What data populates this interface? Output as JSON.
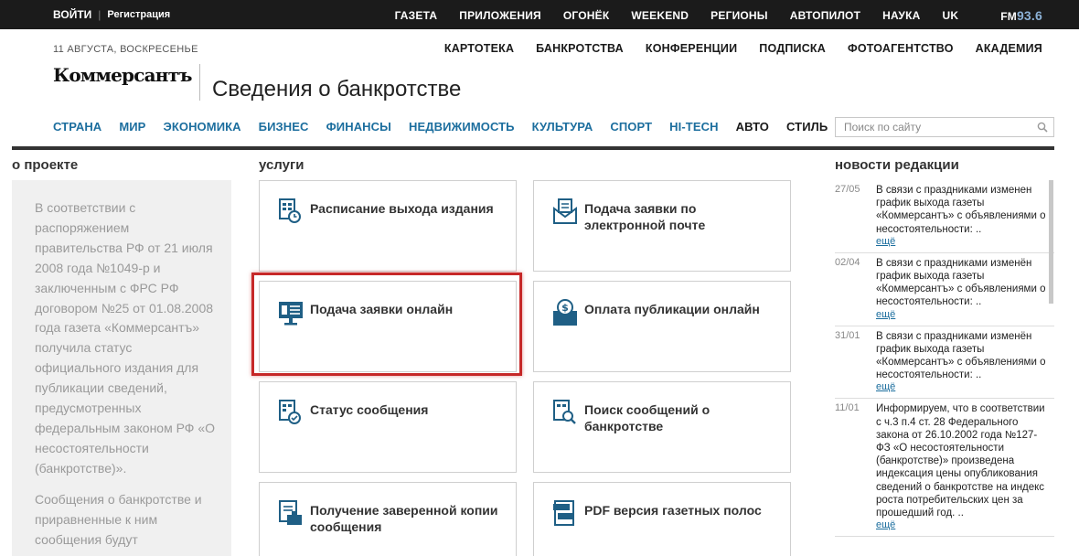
{
  "topbar": {
    "login": "ВОЙТИ",
    "register": "Регистрация",
    "nav": [
      "ГАЗЕТА",
      "ПРИЛОЖЕНИЯ",
      "ОГОНЁК",
      "WEEKEND",
      "РЕГИОНЫ",
      "АВТОПИЛОТ",
      "НАУКА",
      "UK"
    ],
    "fm": "FM",
    "fm_freq": "93.6"
  },
  "header": {
    "date": "11 АВГУСТА, ВОСКРЕСЕНЬЕ",
    "secondary_nav": [
      "КАРТОТЕКА",
      "БАНКРОТСТВА",
      "КОНФЕРЕНЦИИ",
      "ПОДПИСКА",
      "ФОТОАГЕНТСТВО",
      "АКАДЕМИЯ"
    ],
    "logo": "Коммерсантъ",
    "page_title": "Сведения о банкротстве"
  },
  "main_nav": {
    "items": [
      "СТРАНА",
      "МИР",
      "ЭКОНОМИКА",
      "БИЗНЕС",
      "ФИНАНСЫ",
      "НЕДВИЖИМОСТЬ",
      "КУЛЬТУРА",
      "СПОРТ",
      "HI-TECH",
      "АВТО",
      "СТИЛЬ"
    ]
  },
  "search": {
    "placeholder": "Поиск по сайту"
  },
  "about": {
    "heading": "о проекте",
    "p1": "В соответствии с распоряжением правительства РФ от 21 июля 2008 года №1049-р и заключенным с ФРС РФ договором №25 от 01.08.2008 года газета «Коммерсантъ» получила статус официального издания для публикации сведений, предусмотренных федеральным законом РФ «О несостоятельности (банкротстве)».",
    "p2": "Сообщения о банкротстве и приравненные к ним сообщения будут"
  },
  "services": {
    "heading": "услуги",
    "items": [
      {
        "label": "Расписание выхода издания",
        "icon": "schedule-doc-icon"
      },
      {
        "label": "Подача заявки по электронной почте",
        "icon": "email-doc-icon"
      },
      {
        "label": "Подача заявки онлайн",
        "icon": "online-monitor-icon"
      },
      {
        "label": "Оплата публикации онлайн",
        "icon": "payment-bag-icon"
      },
      {
        "label": "Статус сообщения",
        "icon": "status-doc-icon"
      },
      {
        "label": "Поиск сообщений о банкротстве",
        "icon": "search-doc-icon"
      },
      {
        "label": "Получение заверенной копии сообщения",
        "icon": "certified-copy-icon"
      },
      {
        "label": "PDF версия газетных полос",
        "icon": "pdf-xml-icon"
      }
    ]
  },
  "news": {
    "heading": "новости редакции",
    "more_label": "ещё",
    "items": [
      {
        "date": "27/05",
        "text": "В связи с праздниками изменен график выхода газеты «Коммерсантъ» с объявлениями о несостоятельности: .."
      },
      {
        "date": "02/04",
        "text": "В связи с праздниками изменён график выхода газеты «Коммерсантъ» с объявлениями о несостоятельности: .."
      },
      {
        "date": "31/01",
        "text": "В связи с праздниками изменён график выхода газеты «Коммерсантъ» с объявлениями о несостоятельности: .."
      },
      {
        "date": "11/01",
        "text": "Информируем, что в соответствии с ч.3 п.4 ст. 28 Федерального закона от 26.10.2002 года №127-ФЗ «О несостоятельности (банкротстве)» произведена индексация цены опубликования сведений о банкротстве на индекс роста потребительских цен за прошедший год. .."
      }
    ]
  },
  "colors": {
    "accent": "#1c6e9e",
    "highlight": "#c62828",
    "topbar": "#1b1b1b"
  }
}
